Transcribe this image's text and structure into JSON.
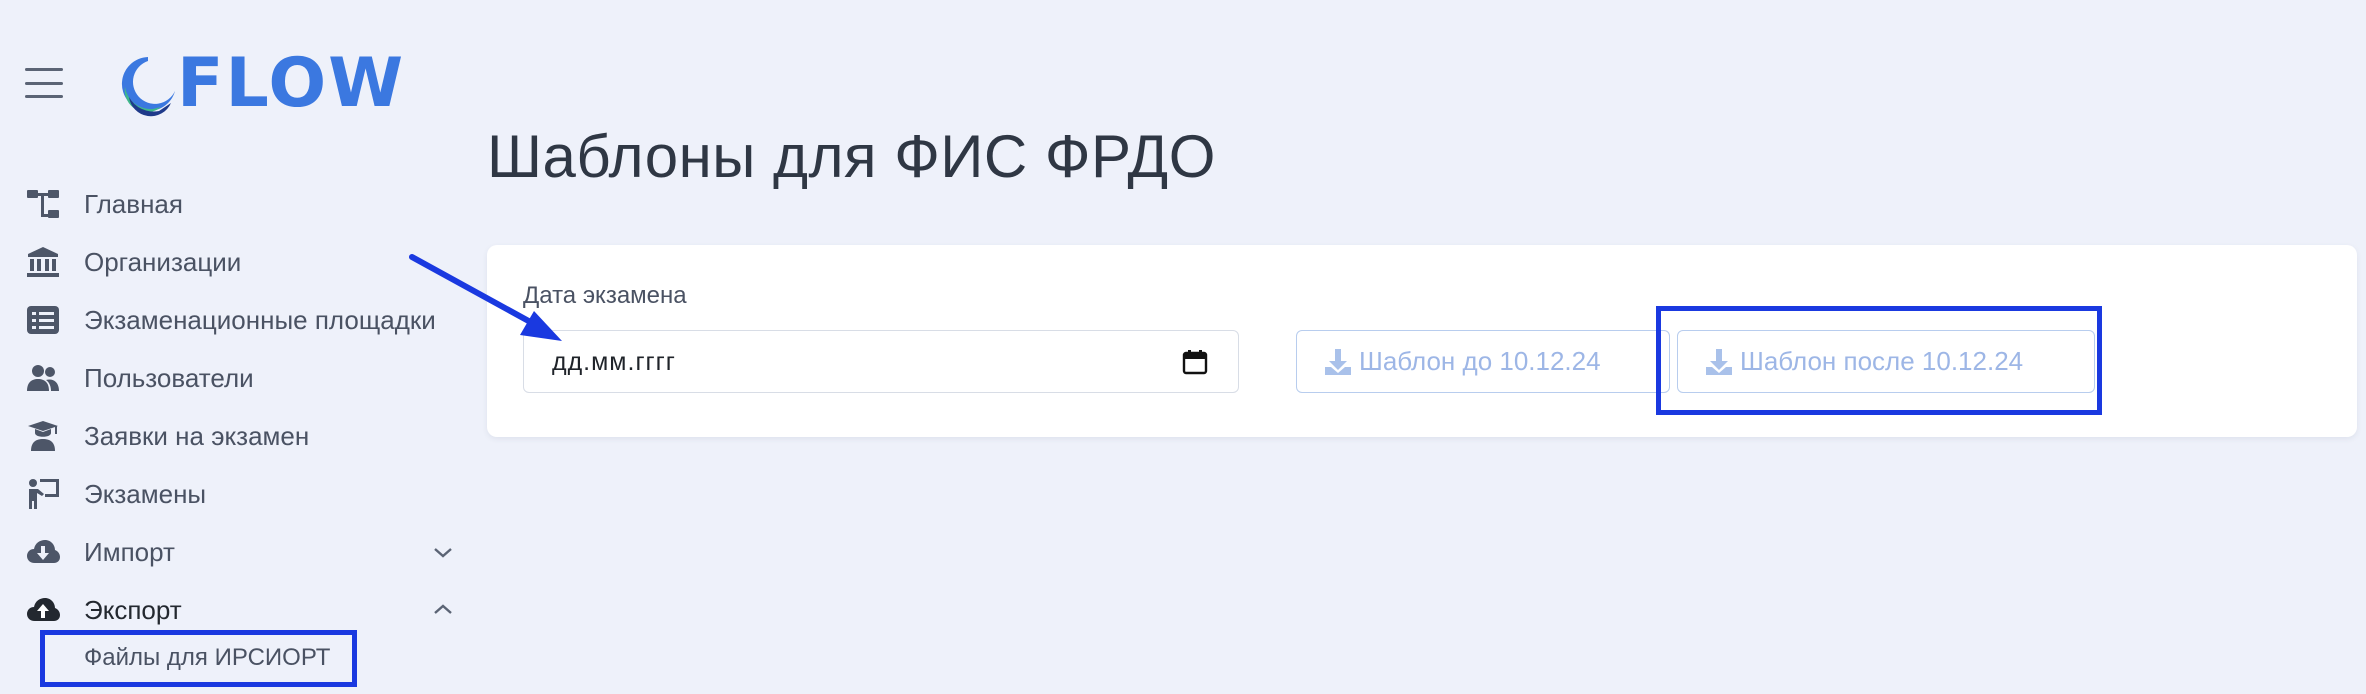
{
  "brand": {
    "logo_text": "FLOW",
    "accent": "#3b78e0"
  },
  "sidebar": {
    "menu_icon": "hamburger-icon",
    "items": [
      {
        "label": "Главная",
        "icon": "sitemap-icon"
      },
      {
        "label": "Организации",
        "icon": "bank-icon"
      },
      {
        "label": "Экзаменационные площадки",
        "icon": "list-icon"
      },
      {
        "label": "Пользователи",
        "icon": "users-icon"
      },
      {
        "label": "Заявки на экзамен",
        "icon": "graduate-icon"
      },
      {
        "label": "Экзамены",
        "icon": "teacher-board-icon"
      },
      {
        "label": "Импорт",
        "icon": "cloud-download-icon",
        "expandable": true,
        "expanded": false
      },
      {
        "label": "Экспорт",
        "icon": "cloud-upload-icon",
        "expandable": true,
        "expanded": true,
        "active": true
      }
    ],
    "sub_items": [
      {
        "label": "Файлы для ИРСИОРТ"
      }
    ]
  },
  "main": {
    "title": "Шаблоны для ФИС ФРДО",
    "form": {
      "date_label": "Дата экзамена",
      "date_placeholder": "дд.мм.гггг",
      "date_value": ""
    },
    "buttons": [
      {
        "label": "Шаблон до 10.12.24",
        "icon": "download-icon",
        "disabled": true
      },
      {
        "label": "Шаблон после 10.12.24",
        "icon": "download-icon",
        "disabled": true
      }
    ]
  },
  "annotations": {
    "highlight_color": "#1a39e0"
  }
}
